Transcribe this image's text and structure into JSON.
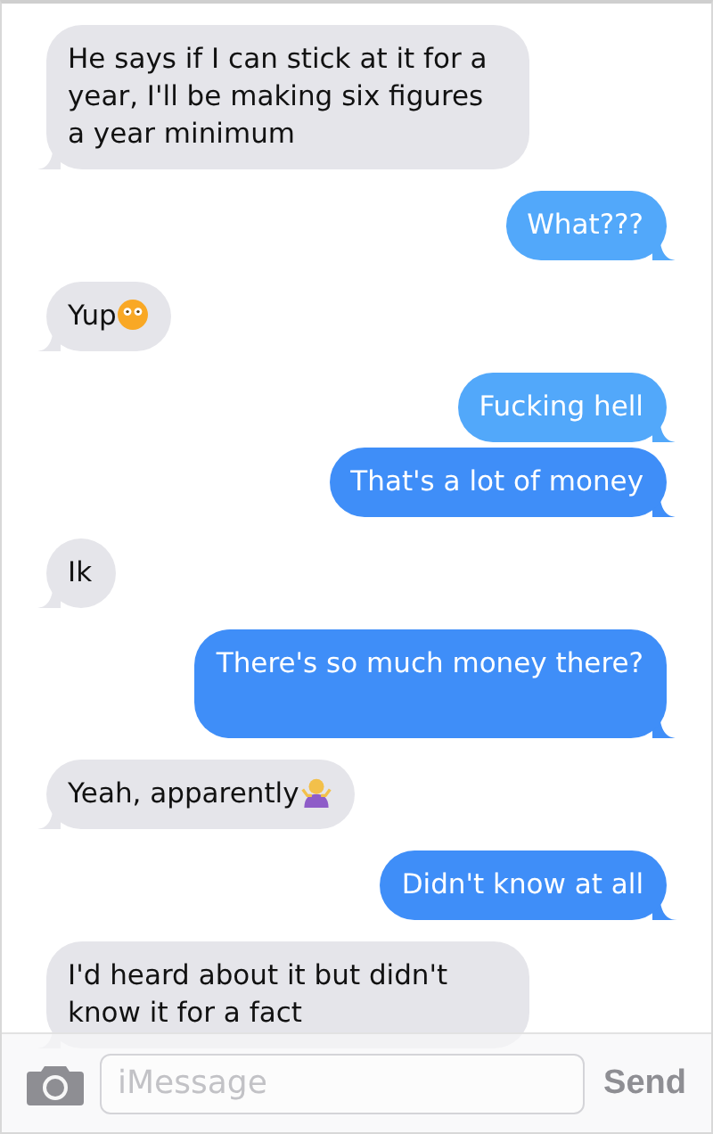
{
  "messages": [
    {
      "kind": "received",
      "text": "He says if I can stick at it for a year, I'll be making six figures a year minimum"
    },
    {
      "kind": "sent",
      "text": "What???"
    },
    {
      "kind": "received",
      "text": "Yup",
      "emoji": {
        "kind": "face"
      }
    },
    {
      "kind": "sent",
      "text": "Fucking hell"
    },
    {
      "kind": "sent",
      "text": "That's a lot of money"
    },
    {
      "kind": "received",
      "text": "Ik"
    },
    {
      "kind": "sent",
      "text": "There's so much money there?",
      "tall": true
    },
    {
      "kind": "received",
      "text": "Yeah, apparently",
      "emoji": {
        "kind": "shrug"
      }
    },
    {
      "kind": "sent",
      "text": "Didn't know at all"
    },
    {
      "kind": "received",
      "text": "I'd heard about it but didn't know it for a fact"
    }
  ],
  "composer": {
    "placeholder": "iMessage",
    "send": "Send"
  }
}
